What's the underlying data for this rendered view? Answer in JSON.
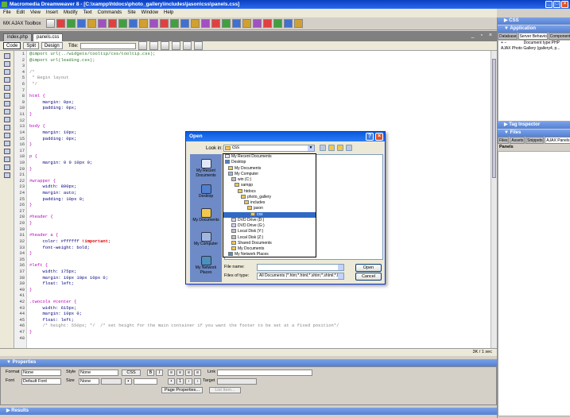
{
  "window": {
    "title": "Macromedia Dreamweaver 8 - [C:\\xampp\\htdocs\\photo_gallery\\includes\\jason\\css\\panels.css]"
  },
  "menu": [
    "File",
    "Edit",
    "View",
    "Insert",
    "Modify",
    "Text",
    "Commands",
    "Site",
    "Window",
    "Help"
  ],
  "toolbar": {
    "insert_bar_label": "MX AJAX Toolbox"
  },
  "doc_tabs": [
    "index.php",
    "panels.css"
  ],
  "doc_toolbar": {
    "code": "Code",
    "split": "Split",
    "design": "Design",
    "title_label": "Title:"
  },
  "code_lines": [
    {
      "n": "1",
      "t": "@import url(../widgets/tooltip/css/tooltip.css);",
      "c": "c-import"
    },
    {
      "n": "2",
      "t": "@import url(leading.css);",
      "c": "c-import"
    },
    {
      "n": "3",
      "t": "",
      "c": ""
    },
    {
      "n": "4",
      "t": "/*",
      "c": "c-comment"
    },
    {
      "n": "5",
      "t": " * Begin layout",
      "c": "c-comment"
    },
    {
      "n": "6",
      "t": " */",
      "c": "c-comment"
    },
    {
      "n": "7",
      "t": "",
      "c": ""
    },
    {
      "n": "8",
      "t": "html {",
      "c": "c-sel"
    },
    {
      "n": "9",
      "t": "     margin: 0px;",
      "c": "c-prop"
    },
    {
      "n": "10",
      "t": "     padding: 0px;",
      "c": "c-prop"
    },
    {
      "n": "11",
      "t": "}",
      "c": "c-sel"
    },
    {
      "n": "12",
      "t": "",
      "c": ""
    },
    {
      "n": "13",
      "t": "body {",
      "c": "c-sel"
    },
    {
      "n": "14",
      "t": "     margin: 10px;",
      "c": "c-prop"
    },
    {
      "n": "15",
      "t": "     padding: 0px;",
      "c": "c-prop"
    },
    {
      "n": "16",
      "t": "}",
      "c": "c-sel"
    },
    {
      "n": "17",
      "t": "",
      "c": ""
    },
    {
      "n": "18",
      "t": "p {",
      "c": "c-sel"
    },
    {
      "n": "19",
      "t": "     margin: 0 0 10px 0;",
      "c": "c-prop"
    },
    {
      "n": "20",
      "t": "}",
      "c": "c-sel"
    },
    {
      "n": "21",
      "t": "",
      "c": ""
    },
    {
      "n": "22",
      "t": "#wrapper {",
      "c": "c-sel"
    },
    {
      "n": "23",
      "t": "     width: 800px;",
      "c": "c-prop"
    },
    {
      "n": "24",
      "t": "     margin: auto;",
      "c": "c-prop"
    },
    {
      "n": "25",
      "t": "     padding: 10px 0;",
      "c": "c-prop"
    },
    {
      "n": "26",
      "t": "}",
      "c": "c-sel"
    },
    {
      "n": "27",
      "t": "",
      "c": ""
    },
    {
      "n": "28",
      "t": "#header {",
      "c": "c-sel"
    },
    {
      "n": "29",
      "t": "}",
      "c": "c-sel"
    },
    {
      "n": "30",
      "t": "",
      "c": ""
    },
    {
      "n": "31",
      "t": "#header a {",
      "c": "c-sel"
    },
    {
      "n": "32",
      "t": "     color: #ffffff ",
      "c": "c-prop",
      "imp": "!important;"
    },
    {
      "n": "33",
      "t": "     font-weight: bold;",
      "c": "c-prop"
    },
    {
      "n": "34",
      "t": "}",
      "c": "c-sel"
    },
    {
      "n": "35",
      "t": "",
      "c": ""
    },
    {
      "n": "36",
      "t": "#left {",
      "c": "c-sel"
    },
    {
      "n": "37",
      "t": "     width: 175px;",
      "c": "c-prop"
    },
    {
      "n": "38",
      "t": "     margin: 10px 10px 10px 0;",
      "c": "c-prop"
    },
    {
      "n": "39",
      "t": "     float: left;",
      "c": "c-prop"
    },
    {
      "n": "40",
      "t": "}",
      "c": "c-sel"
    },
    {
      "n": "41",
      "t": "",
      "c": ""
    },
    {
      "n": "42",
      "t": ".twocols #center {",
      "c": "c-sel"
    },
    {
      "n": "43",
      "t": "     width: 615px;",
      "c": "c-prop"
    },
    {
      "n": "44",
      "t": "     margin: 10px 0;",
      "c": "c-prop"
    },
    {
      "n": "45",
      "t": "     float: left;",
      "c": "c-prop"
    },
    {
      "n": "46",
      "t": "     /* height: 550px; */  /* set height for the main container if you want the footer to be set at a fixed position*/",
      "c": "c-comment"
    },
    {
      "n": "47",
      "t": "}",
      "c": "c-sel"
    },
    {
      "n": "48",
      "t": "",
      "c": ""
    }
  ],
  "status": {
    "size": "3K / 1 sec"
  },
  "properties": {
    "title": "Properties",
    "format_label": "Format",
    "format_value": "None",
    "style_label": "Style",
    "style_value": "None",
    "css_btn": "CSS",
    "font_label": "Font",
    "font_value": "Default Font",
    "size_label": "Size",
    "size_value": "None",
    "link_label": "Link",
    "target_label": "Target",
    "page_props_btn": "Page Properties...",
    "list_item_btn": "List Item..."
  },
  "results": {
    "title": "Results"
  },
  "right_panel": {
    "css_title": "CSS",
    "application_title": "Application",
    "app_tabs": [
      "Databases",
      "Server Behaviors",
      "Components"
    ],
    "doc_type": "Document type:PHP",
    "sb_item": "AJAX Photo Gallery (gallery4, p...",
    "tag_inspector_title": "Tag Inspector",
    "files_title": "Files",
    "files_tabs": [
      "Files",
      "Assets",
      "Snippets",
      "AJAX Panels"
    ],
    "panels_label": "Panels"
  },
  "dialog": {
    "title": "Open",
    "lookin_label": "Look in:",
    "lookin_value": "css",
    "places": [
      "My Recent Documents",
      "Desktop",
      "My Documents",
      "My Computer",
      "My Network Places"
    ],
    "dropdown": [
      {
        "label": "My Recent Documents",
        "indent": 0,
        "icon": "recent"
      },
      {
        "label": "Desktop",
        "indent": 0,
        "icon": "desktop"
      },
      {
        "label": "My Documents",
        "indent": 1,
        "icon": "folder"
      },
      {
        "label": "My Computer",
        "indent": 1,
        "icon": "computer"
      },
      {
        "label": "win (C:)",
        "indent": 2,
        "icon": "drive"
      },
      {
        "label": "xampp",
        "indent": 3,
        "icon": "folder"
      },
      {
        "label": "htdocs",
        "indent": 4,
        "icon": "folder"
      },
      {
        "label": "photo_gallery",
        "indent": 5,
        "icon": "folder"
      },
      {
        "label": "includes",
        "indent": 6,
        "icon": "folder"
      },
      {
        "label": "jason",
        "indent": 7,
        "icon": "folder"
      },
      {
        "label": "css",
        "indent": 8,
        "icon": "folder",
        "hl": true
      },
      {
        "label": "DVD Drive (D:)",
        "indent": 2,
        "icon": "dvd"
      },
      {
        "label": "DVD Drive (G:)",
        "indent": 2,
        "icon": "dvd"
      },
      {
        "label": "Local Disk (Y:)",
        "indent": 2,
        "icon": "drive"
      },
      {
        "label": "Local Disk (Z:)",
        "indent": 2,
        "icon": "drive"
      },
      {
        "label": "Shared Documents",
        "indent": 2,
        "icon": "folder"
      },
      {
        "label": "My Documents",
        "indent": 2,
        "icon": "folder"
      },
      {
        "label": "My Network Places",
        "indent": 1,
        "icon": "network"
      }
    ],
    "file_name_label": "File name:",
    "file_name_value": "",
    "files_type_label": "Files of type:",
    "files_type_value": "All Documents (*.htm;*.html;*.shtm;*.shtml;*.hta",
    "open_btn": "Open",
    "cancel_btn": "Cancel"
  }
}
